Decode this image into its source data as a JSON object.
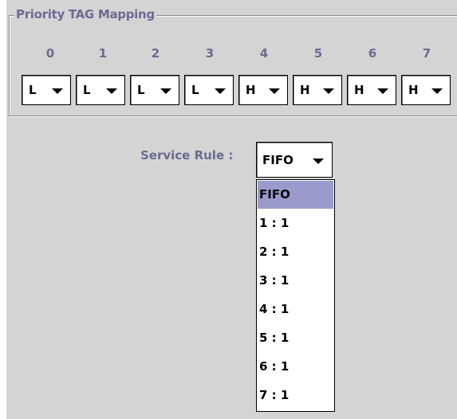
{
  "group": {
    "title": "Priority TAG Mapping",
    "tags": [
      "0",
      "1",
      "2",
      "3",
      "4",
      "5",
      "6",
      "7"
    ],
    "values": [
      "L",
      "L",
      "L",
      "L",
      "H",
      "H",
      "H",
      "H"
    ]
  },
  "service_rule": {
    "label": "Service Rule :",
    "value": "FIFO",
    "options": [
      "FIFO",
      "1 : 1",
      "2 : 1",
      "3 : 1",
      "4 : 1",
      "5 : 1",
      "6 : 1",
      "7 : 1"
    ],
    "highlighted_option": "FIFO"
  },
  "colors": {
    "panel_bg": "#d4d4d4",
    "label_text": "#6b6b94",
    "selection_bg": "#9a9acc"
  },
  "icons": {
    "combo_arrow": "caret-down-icon"
  }
}
